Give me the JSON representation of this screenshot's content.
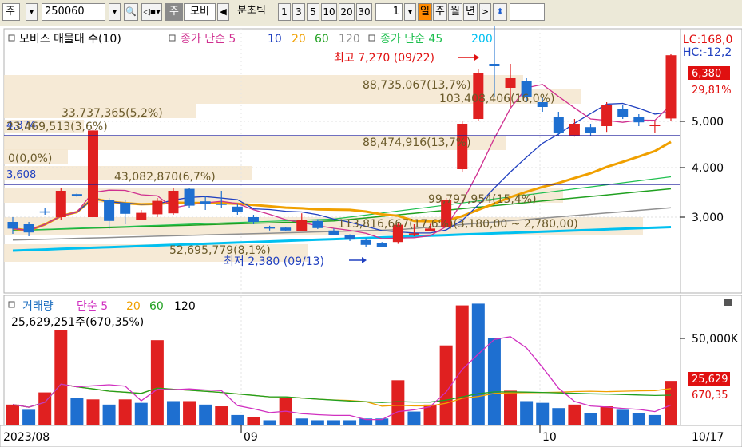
{
  "toolbar": {
    "market_label": "주",
    "code_value": "250060",
    "stock_button_label": "주",
    "stock_name": "모비",
    "period_prefix": "분초틱",
    "period_options": [
      "1",
      "3",
      "5",
      "10",
      "20",
      "30"
    ],
    "period_count": "1",
    "day_label": "일",
    "week_label": "주",
    "month_label": "월",
    "year_label": "년",
    "nav_next": ">",
    "nav_prev": "◀"
  },
  "price_panel": {
    "legend_items": [
      {
        "text": "모비스 매물대 수(10)",
        "color": "#000000"
      },
      {
        "text": "종가 단순 5",
        "color": "#d03090"
      },
      {
        "text": "10",
        "color": "#2040c0"
      },
      {
        "text": "20",
        "color": "#f0a000"
      },
      {
        "text": "60",
        "color": "#20a020"
      },
      {
        "text": "120",
        "color": "#909090"
      },
      {
        "text": "종가 단순 45",
        "color": "#20c050"
      },
      {
        "text": "200",
        "color": "#00c0f0"
      }
    ],
    "lc_label": "LC:168,0",
    "hc_label": "HC:-12,2",
    "current_price": "6,380",
    "current_change": "29,81%",
    "axis_labels": [
      "5,000",
      "4,000",
      "3,000"
    ],
    "left_labels": {
      "top": "4,874",
      "bottom": "3,608"
    },
    "high_label": "최고 7,270 (09/22)",
    "low_label": "최저 2,380 (09/13)",
    "volume_profile_labels": [
      "88,735,067(13,7%)",
      "103,408,406(16,0%)",
      "33,737,365(5,2%)",
      "23,469,513(3,6%)",
      "0(0,0%)",
      "88,474,916(13,7%)",
      "43,082,870(6,7%)",
      "99,797,954(15,4%)",
      "113,816,667(17,6%)(3,180,00 ~ 2,780,00)",
      "52,695,779(8,1%)"
    ]
  },
  "volume_panel": {
    "legend_items": [
      {
        "text": "거래량",
        "color": "#2070c0"
      },
      {
        "text": "단순 5",
        "color": "#d030c0"
      },
      {
        "text": "20",
        "color": "#f0a000"
      },
      {
        "text": "60",
        "color": "#20a020"
      },
      {
        "text": "120",
        "color": "#000000"
      }
    ],
    "volume_text": "25,629,251주(670,35%)",
    "axis_label": "50,000K",
    "current_volume": "25,629",
    "current_volume_pct": "670,35"
  },
  "date_axis": [
    "2023/08",
    "09",
    "10",
    "10/17"
  ],
  "chart_data": {
    "type": "candlestick",
    "candles": [
      {
        "o": 2900,
        "c": 2760,
        "h": 3000,
        "l": 2650
      },
      {
        "o": 2850,
        "c": 2680,
        "h": 2900,
        "l": 2600
      },
      {
        "o": 3120,
        "c": 3100,
        "h": 3200,
        "l": 3050
      },
      {
        "o": 3000,
        "c": 3550,
        "h": 3600,
        "l": 2950
      },
      {
        "o": 3480,
        "c": 3440,
        "h": 3500,
        "l": 3420
      },
      {
        "o": 3000,
        "c": 4810,
        "h": 4874,
        "l": 3000
      },
      {
        "o": 3350,
        "c": 2920,
        "h": 3400,
        "l": 2750
      },
      {
        "o": 3300,
        "c": 3070,
        "h": 3350,
        "l": 2850
      },
      {
        "o": 2950,
        "c": 3090,
        "h": 3150,
        "l": 2950
      },
      {
        "o": 3060,
        "c": 3340,
        "h": 3400,
        "l": 3000
      },
      {
        "o": 3080,
        "c": 3550,
        "h": 3600,
        "l": 3050
      },
      {
        "o": 3590,
        "c": 3240,
        "h": 3600,
        "l": 3200
      },
      {
        "o": 3330,
        "c": 3270,
        "h": 3450,
        "l": 3150
      },
      {
        "o": 3280,
        "c": 3260,
        "h": 3550,
        "l": 3200
      },
      {
        "o": 3220,
        "c": 3100,
        "h": 3280,
        "l": 3050
      },
      {
        "o": 3000,
        "c": 2900,
        "h": 3050,
        "l": 2850
      },
      {
        "o": 2800,
        "c": 2760,
        "h": 2820,
        "l": 2720
      },
      {
        "o": 2780,
        "c": 2720,
        "h": 2790,
        "l": 2700
      },
      {
        "o": 2700,
        "c": 2950,
        "h": 3080,
        "l": 2700
      },
      {
        "o": 2920,
        "c": 2770,
        "h": 2960,
        "l": 2750
      },
      {
        "o": 2720,
        "c": 2630,
        "h": 2760,
        "l": 2620
      },
      {
        "o": 2620,
        "c": 2550,
        "h": 2640,
        "l": 2500
      },
      {
        "o": 2520,
        "c": 2420,
        "h": 2560,
        "l": 2380
      },
      {
        "o": 2460,
        "c": 2380,
        "h": 2480,
        "l": 2380
      },
      {
        "o": 2480,
        "c": 2840,
        "h": 2880,
        "l": 2440
      },
      {
        "o": 2650,
        "c": 2660,
        "h": 2850,
        "l": 2600
      },
      {
        "o": 2700,
        "c": 2760,
        "h": 2860,
        "l": 2700
      },
      {
        "o": 2800,
        "c": 3360,
        "h": 3400,
        "l": 2780
      },
      {
        "o": 4000,
        "c": 4950,
        "h": 5000,
        "l": 3950
      },
      {
        "o": 5050,
        "c": 6000,
        "h": 6100,
        "l": 5000
      },
      {
        "o": 6200,
        "c": 6150,
        "h": 7270,
        "l": 5500
      },
      {
        "o": 5700,
        "c": 5900,
        "h": 6200,
        "l": 5300
      },
      {
        "o": 5850,
        "c": 5500,
        "h": 5900,
        "l": 5400
      },
      {
        "o": 5400,
        "c": 5300,
        "h": 5500,
        "l": 5200
      },
      {
        "o": 5100,
        "c": 4750,
        "h": 5200,
        "l": 4700
      },
      {
        "o": 4700,
        "c": 4950,
        "h": 5050,
        "l": 4680
      },
      {
        "o": 4880,
        "c": 4750,
        "h": 4950,
        "l": 4700
      },
      {
        "o": 4900,
        "c": 5350,
        "h": 5400,
        "l": 4780
      },
      {
        "o": 5250,
        "c": 5100,
        "h": 5350,
        "l": 5050
      },
      {
        "o": 5100,
        "c": 4980,
        "h": 5150,
        "l": 4900
      },
      {
        "o": 4900,
        "c": 4930,
        "h": 5000,
        "l": 4750
      },
      {
        "o": 5060,
        "c": 6380,
        "h": 6400,
        "l": 5000
      }
    ],
    "volumes": [
      {
        "v": 12000,
        "up": true
      },
      {
        "v": 9000,
        "up": false
      },
      {
        "v": 19000,
        "up": true
      },
      {
        "v": 55000,
        "up": true
      },
      {
        "v": 16000,
        "up": false
      },
      {
        "v": 15000,
        "up": true
      },
      {
        "v": 12000,
        "up": false
      },
      {
        "v": 15000,
        "up": true
      },
      {
        "v": 13000,
        "up": false
      },
      {
        "v": 49000,
        "up": true
      },
      {
        "v": 14000,
        "up": false
      },
      {
        "v": 14000,
        "up": true
      },
      {
        "v": 12000,
        "up": false
      },
      {
        "v": 11000,
        "up": true
      },
      {
        "v": 6000,
        "up": false
      },
      {
        "v": 5000,
        "up": true
      },
      {
        "v": 3000,
        "up": false
      },
      {
        "v": 16000,
        "up": true
      },
      {
        "v": 4000,
        "up": false
      },
      {
        "v": 3000,
        "up": false
      },
      {
        "v": 3000,
        "up": false
      },
      {
        "v": 3000,
        "up": false
      },
      {
        "v": 4000,
        "up": false
      },
      {
        "v": 4000,
        "up": false
      },
      {
        "v": 26000,
        "up": true
      },
      {
        "v": 8000,
        "up": false
      },
      {
        "v": 12000,
        "up": true
      },
      {
        "v": 46000,
        "up": true
      },
      {
        "v": 69000,
        "up": true
      },
      {
        "v": 70000,
        "up": false
      },
      {
        "v": 50000,
        "up": false
      },
      {
        "v": 20000,
        "up": true
      },
      {
        "v": 14000,
        "up": false
      },
      {
        "v": 13000,
        "up": false
      },
      {
        "v": 10000,
        "up": false
      },
      {
        "v": 12000,
        "up": true
      },
      {
        "v": 7000,
        "up": false
      },
      {
        "v": 11000,
        "up": true
      },
      {
        "v": 9000,
        "up": false
      },
      {
        "v": 7000,
        "up": false
      },
      {
        "v": 6000,
        "up": false
      },
      {
        "v": 25629,
        "up": true
      }
    ]
  }
}
